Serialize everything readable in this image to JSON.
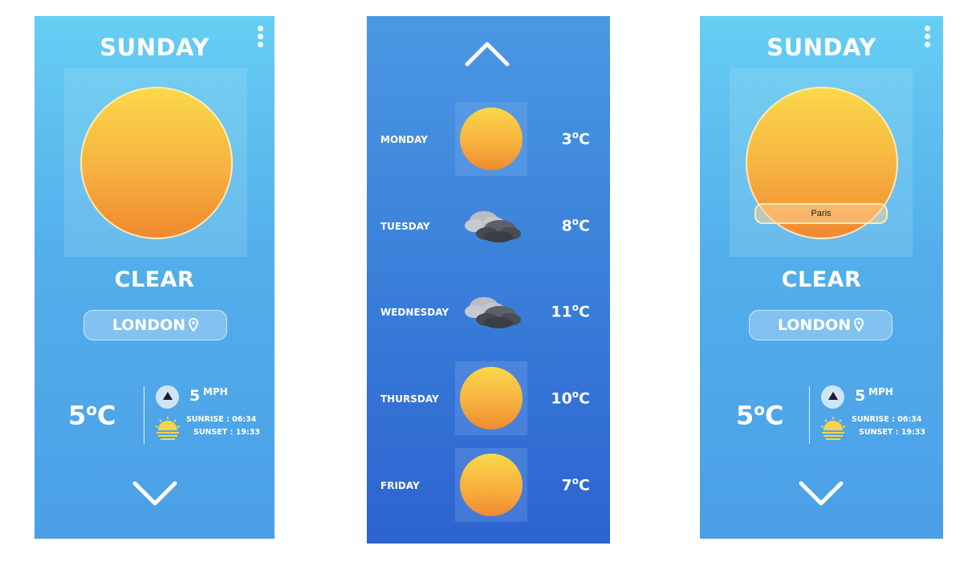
{
  "current": {
    "day": "SUNDAY",
    "condition": "CLEAR",
    "location": "LONDON",
    "temp_value": "5",
    "temp_unit": "C",
    "wind_value": "5",
    "wind_unit": "MPH",
    "sunrise": "SUNRISE : 06:34",
    "sunset": "SUNSET : 19:33"
  },
  "forecast": [
    {
      "day": "MONDAY",
      "temp_value": "3",
      "temp_unit": "C",
      "icon": "sun-icon"
    },
    {
      "day": "TUESDAY",
      "temp_value": "8",
      "temp_unit": "C",
      "icon": "cloud-icon"
    },
    {
      "day": "WEDNESDAY",
      "temp_value": "11",
      "temp_unit": "C",
      "icon": "cloud-icon"
    },
    {
      "day": "THURSDAY",
      "temp_value": "10",
      "temp_unit": "C",
      "icon": "sun-icon"
    },
    {
      "day": "FRIDAY",
      "temp_value": "7",
      "temp_unit": "C",
      "icon": "sun-icon"
    }
  ],
  "search": {
    "value": "Paris"
  },
  "colors": {
    "sky_light": "#67cef3",
    "sky_dark": "#2c63d0",
    "sun_top": "#fad94a",
    "sun_bottom": "#f08930"
  }
}
